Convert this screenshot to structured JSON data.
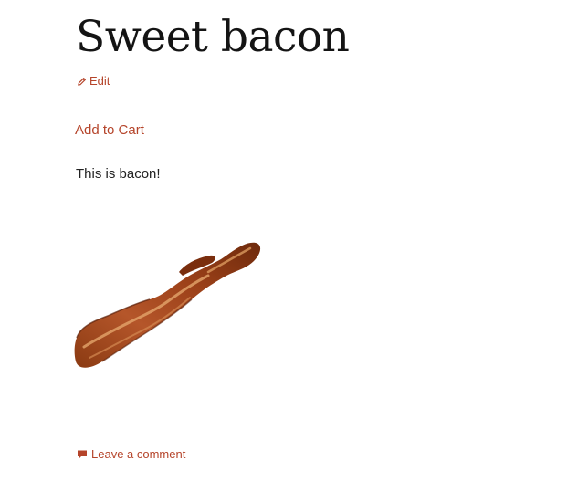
{
  "post": {
    "title": "Sweet bacon",
    "edit_label": "Edit",
    "add_to_cart_label": "Add to Cart",
    "description": "This is bacon!",
    "image_subject": "bacon strip",
    "comment_label": "Leave a comment"
  },
  "icons": {
    "edit": "pencil-icon",
    "comment": "comment-bubble-icon"
  },
  "colors": {
    "link": "#b5442a",
    "title": "#141414",
    "text": "#222222",
    "background": "#ffffff"
  }
}
